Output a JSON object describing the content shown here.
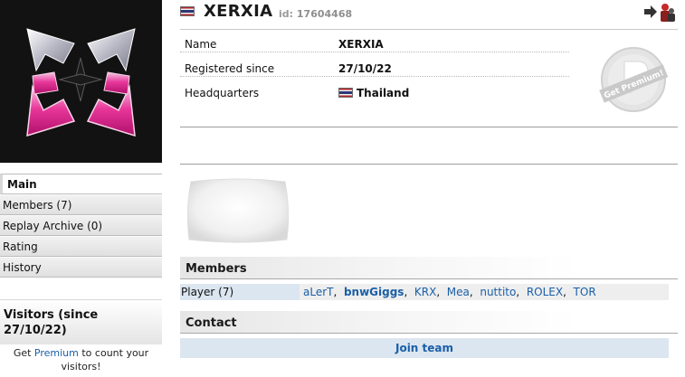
{
  "team": {
    "name": "XERXIA",
    "id_label": "id:",
    "id_value": "17604468"
  },
  "colors": {
    "link": "#1a5fa8",
    "button_bg": "#dce6f0",
    "logo_pink": "#e8379a",
    "flag_red": "#b4242c",
    "flag_blue": "#2c3777"
  },
  "icons": {
    "country_flag": "thailand-flag-icon",
    "action": "leave-team-icon",
    "premium": "get-premium-badge"
  },
  "info": {
    "rows": [
      {
        "label": "Name",
        "value": "XERXIA"
      },
      {
        "label": "Registered since",
        "value": "27/10/22"
      },
      {
        "label": "Headquarters",
        "value": "Thailand"
      }
    ]
  },
  "premium_badge": {
    "text": "Get Premium!"
  },
  "nav": {
    "items": [
      {
        "label": "Main"
      },
      {
        "label": "Members (7)"
      },
      {
        "label": "Replay Archive (0)"
      },
      {
        "label": "Rating"
      },
      {
        "label": "History"
      }
    ]
  },
  "visitors": {
    "title": "Visitors (since 27/10/22)",
    "note_before": "Get ",
    "note_link": "Premium",
    "note_after": " to count your visitors!"
  },
  "members": {
    "title": "Members",
    "player_label": "Player (7)",
    "players": [
      {
        "name": "aLerT",
        "bold": false
      },
      {
        "name": "bnwGiggs",
        "bold": true
      },
      {
        "name": "KRX",
        "bold": false
      },
      {
        "name": "Mea",
        "bold": false
      },
      {
        "name": "nuttito",
        "bold": false
      },
      {
        "name": "ROLEX",
        "bold": false
      },
      {
        "name": "TOR",
        "bold": false
      }
    ]
  },
  "contact": {
    "title": "Contact",
    "join_label": "Join team"
  }
}
